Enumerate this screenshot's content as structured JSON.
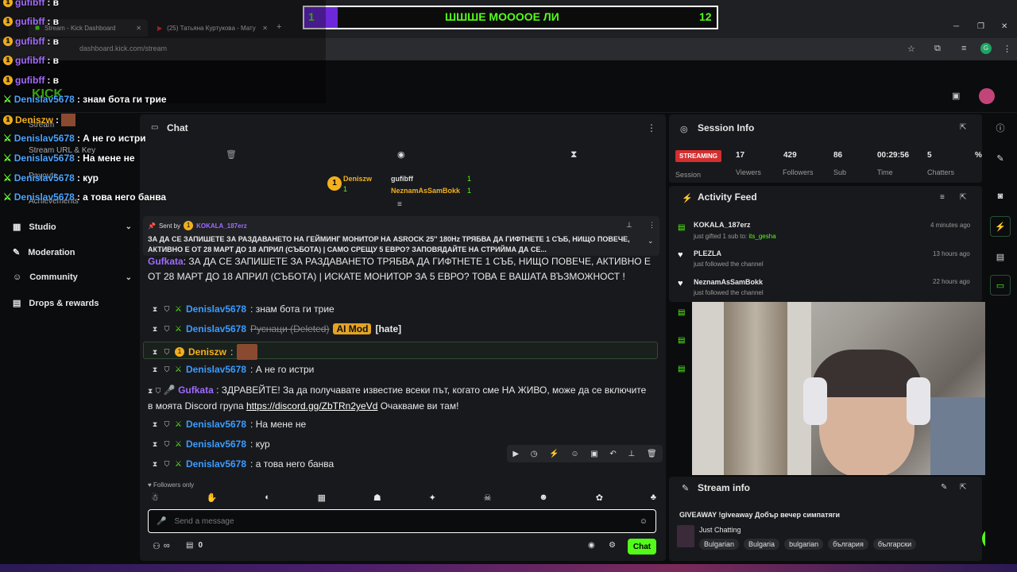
{
  "browser": {
    "tab1": "Stream - Kick Dashboard",
    "tab2": "(25) Татьяна Куртукова - Мату",
    "url": "dashboard.kick.com/stream"
  },
  "poll": {
    "left_num": "1",
    "question": "ШШШЕ МОООOE ЛИ",
    "right_num": "12",
    "fill_fraction": 0.08
  },
  "overlay": {
    "lines": [
      {
        "user": "gufibff",
        "text": ": в"
      },
      {
        "user": "gufibff",
        "text": ": в"
      },
      {
        "user": "gufibff",
        "text": ": в"
      },
      {
        "user": "gufibff",
        "text": ": в"
      },
      {
        "user": "gufibff",
        "text": ": в"
      },
      {
        "user": "Denislav5678",
        "text": ": знам бота ги трие"
      },
      {
        "user": "Deniszw",
        "text": ":"
      },
      {
        "user": "Denislav5678",
        "text": ": А не го истри"
      },
      {
        "user": "Denislav5678",
        "text": ": На мене не"
      },
      {
        "user": "Denislav5678",
        "text": ": кур"
      },
      {
        "user": "Denislav5678",
        "text": ": а това него банва"
      }
    ]
  },
  "sidebar": {
    "sub_items": [
      "Stream",
      "Stream URL & Key",
      "Payouts",
      "Achievements"
    ],
    "items": [
      {
        "label": "Studio",
        "icon": "studio-icon",
        "chevron": true
      },
      {
        "label": "Moderation",
        "icon": "wrench-icon",
        "chevron": false
      },
      {
        "label": "Community",
        "icon": "people-icon",
        "chevron": true
      },
      {
        "label": "Drops & rewards",
        "icon": "gift-icon",
        "chevron": false
      }
    ]
  },
  "chat": {
    "title": "Chat",
    "leaderboard": {
      "first": {
        "name": "Deniszw",
        "count": "1"
      },
      "second": {
        "name": "gufibff",
        "count": "1"
      },
      "third": {
        "name": "NeznamAsSamBokk",
        "count": "1"
      }
    },
    "pinned": {
      "sent_by_label": "Sent by",
      "sent_by_user": "KOKALA_187erz",
      "text": "ЗА ДА СЕ ЗАПИШЕТЕ ЗА РАЗДАВАНЕТО НА ГЕЙМИНГ МОНИТОР НА ASROCK 25'' 180Hz ТРЯБВА ДА ГИФТНЕТЕ 1 СЪБ, НИЩО ПОВЕЧЕ, АКТИВНО Е ОТ 28 МАРТ ДО 18 АПРИЛ (СЪБОТА) | САМО СРЕЩУ 5 ЕВРО? ЗАПОВЯДАЙТЕ НА СТРИЙМА ДА СЕ..."
    },
    "messages": [
      {
        "user": "Gufkata",
        "text": "ЗА ДА СЕ ЗАПИШЕТЕ ЗА РАЗДАВАНЕТО ТРЯБВА ДА ГИФТНЕТЕ 1 СЪБ, НИЩО ПОВЕЧЕ, АКТИВНО Е ОТ 28 МАРТ ДО 18 АПРИЛ (СЪБОТА) | ИСКАТЕ МОНИТОР ЗА 5 ЕВРО? ТОВА Е ВАШАТА ВЪЗМОЖНОСТ !"
      },
      {
        "user": "Denislav5678",
        "text": ": знам бота ги трие"
      },
      {
        "user": "Denislav5678",
        "text": "Руснаци (Deleted)",
        "tag": "AI Mod",
        "tag2": "[hate]"
      },
      {
        "user": "Deniszw",
        "text": ":"
      },
      {
        "user": "Denislav5678",
        "text": ": А не го истри"
      },
      {
        "user": "Gufkata",
        "text": ": ЗДРАВЕЙТЕ! За да получавате известие всеки път, когато сме НА ЖИВО, може да се включите в моята Discord група",
        "link": "https://discord.gg/ZbTRn2yeVd",
        "after": "Очакваме ви там!"
      },
      {
        "user": "Denislav5678",
        "text": ": На мене не"
      },
      {
        "user": "Denislav5678",
        "text": ": кур"
      },
      {
        "user": "Denislav5678",
        "text": ": а това него банва"
      }
    ],
    "followers_only": "Followers only",
    "input_placeholder": "Send a message",
    "infinity": "∞",
    "gift_count": "0",
    "send_label": "Chat"
  },
  "session": {
    "title": "Session Info",
    "status": "STREAMING",
    "session_label": "Session",
    "stats": [
      {
        "value": "17",
        "label": "Viewers"
      },
      {
        "value": "429",
        "label": "Followers"
      },
      {
        "value": "86",
        "label": "Sub"
      },
      {
        "value": "00:29:56",
        "label": "Time"
      },
      {
        "value": "5",
        "label": "Chatters"
      },
      {
        "value": "%",
        "label": ""
      }
    ]
  },
  "activity": {
    "title": "Activity Feed",
    "items": [
      {
        "name": "KOKALA_187erz",
        "sub": "just gifted 1 sub to:",
        "target": "its_gesha",
        "time": "4 minutes ago",
        "icon": "gift-icon"
      },
      {
        "name": "PLEZLA",
        "sub": "just followed the channel",
        "time": "13 hours ago",
        "icon": "heart-icon"
      },
      {
        "name": "NeznamAsSamBokk",
        "sub": "just followed the channel",
        "time": "22 hours ago",
        "icon": "heart-icon"
      }
    ]
  },
  "stream_info": {
    "title": "Stream info",
    "stream_title": "GIVEAWAY !giveaway Добър вечер симпатяги",
    "category": "Just Chatting",
    "tags": [
      "Bulgarian",
      "Bulgaria",
      "bulgarian",
      "българия",
      "български"
    ]
  },
  "colors": {
    "accent": "#53fc18",
    "user_blue": "#3b9cff",
    "user_purple": "#9d6bff",
    "streaming_red": "#d32f2f"
  }
}
